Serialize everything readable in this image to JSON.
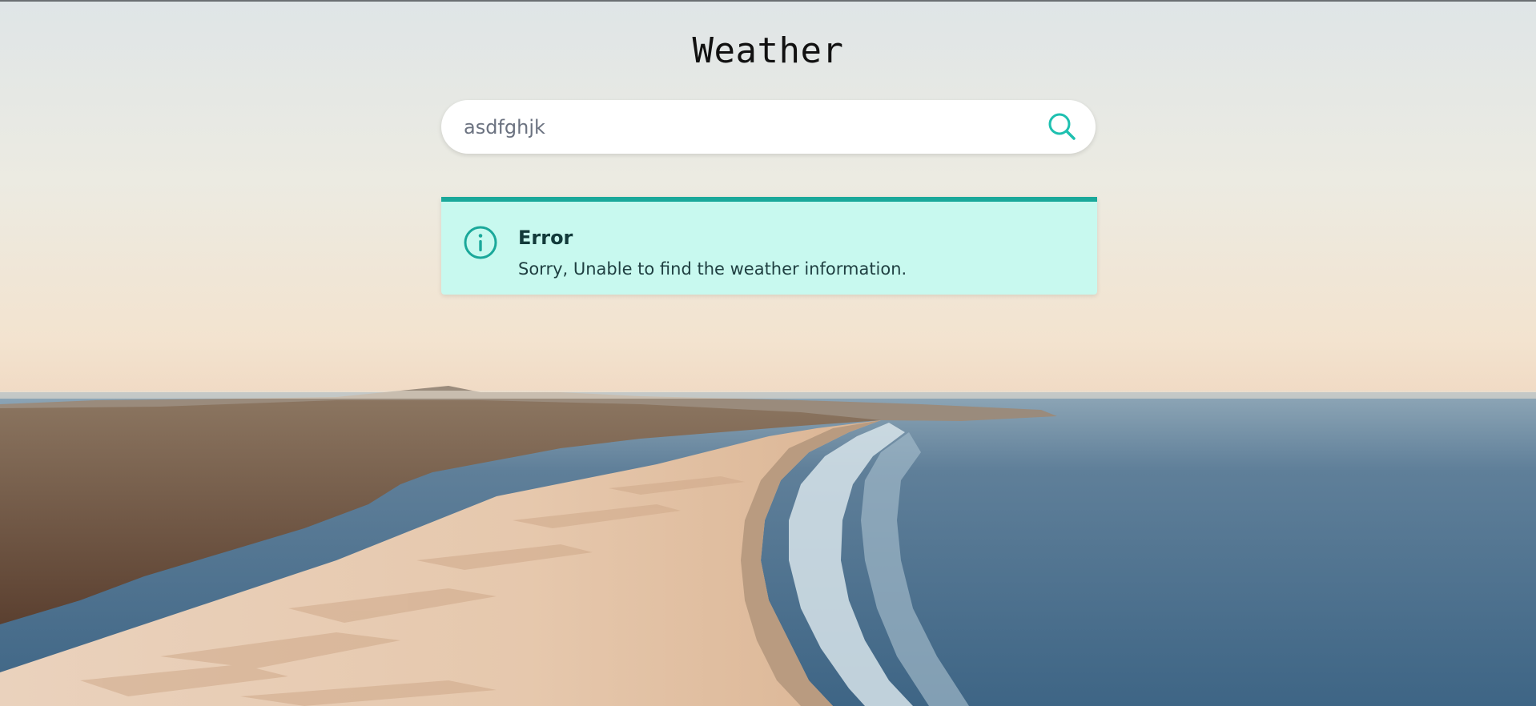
{
  "page": {
    "title": "Weather"
  },
  "search": {
    "value": "asdfghjk",
    "icon": "search-icon"
  },
  "alert": {
    "icon": "info-icon",
    "title": "Error",
    "message": "Sorry, Unable to find the weather information.",
    "accent_color": "#1aa89a",
    "background_color": "#c8f9ef"
  },
  "background": {
    "description_icon": "beach-landscape-image"
  }
}
